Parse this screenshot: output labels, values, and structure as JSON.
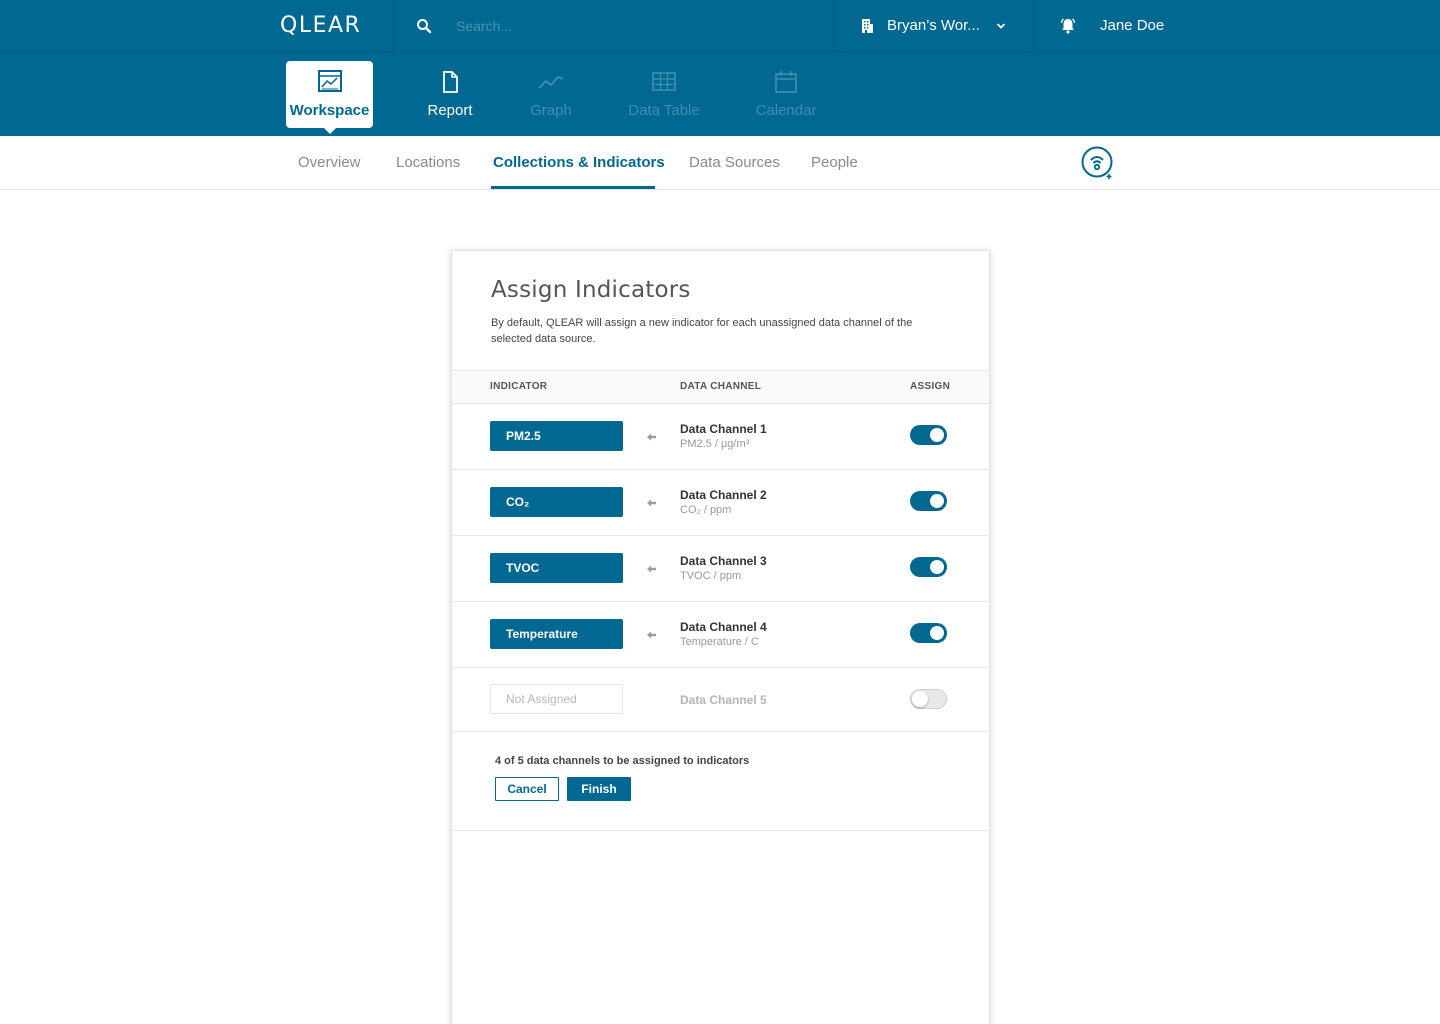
{
  "colors": {
    "brand": "#016892",
    "text": "#333333",
    "muted": "#8a8a8a"
  },
  "header": {
    "logo": "QLEAR",
    "search_placeholder": "Search...",
    "workspace": "Bryan’s Wor...",
    "user": "Jane Doe",
    "icons": [
      "search-icon",
      "building-icon",
      "chevron-down-icon",
      "bell-icon"
    ]
  },
  "modules": [
    {
      "label": "Workspace",
      "icon": "workspace-chart-icon",
      "state": "active"
    },
    {
      "label": "Report",
      "icon": "document-icon",
      "state": "enabled"
    },
    {
      "label": "Graph",
      "icon": "line-graph-icon",
      "state": "disabled"
    },
    {
      "label": "Data Table",
      "icon": "table-icon",
      "state": "disabled"
    },
    {
      "label": "Calendar",
      "icon": "calendar-icon",
      "state": "disabled"
    }
  ],
  "subnav": {
    "tabs": [
      "Overview",
      "Locations",
      "Collections & Indicators",
      "Data Sources",
      "People"
    ],
    "active": "Collections & Indicators",
    "action_icon": "add-sensor-icon"
  },
  "card": {
    "title": "Assign Indicators",
    "description": "By default, QLEAR will assign a new indicator for each unassigned data channel of the selected data source.",
    "columns": {
      "indicator": "INDICATOR",
      "channel": "DATA CHANNEL",
      "assign": "ASSIGN"
    },
    "rows": [
      {
        "indicator": "PM2.5",
        "channel": "Data Channel 1",
        "detail": "PM2.5 / µg/m³",
        "assigned": true
      },
      {
        "indicator": "CO₂",
        "channel": "Data Channel 2",
        "detail": "CO₂ / ppm",
        "assigned": true
      },
      {
        "indicator": "TVOC",
        "channel": "Data Channel 3",
        "detail": "TVOC / ppm",
        "assigned": true
      },
      {
        "indicator": "Temperature",
        "channel": "Data Channel 4",
        "detail": "Temperature / C",
        "assigned": true
      }
    ],
    "unassigned_row": {
      "placeholder": "Not Assigned",
      "channel": "Data Channel 5",
      "assigned": false
    },
    "summary": "4 of 5 data channels to be assigned to indicators",
    "cancel": "Cancel",
    "finish": "Finish"
  }
}
